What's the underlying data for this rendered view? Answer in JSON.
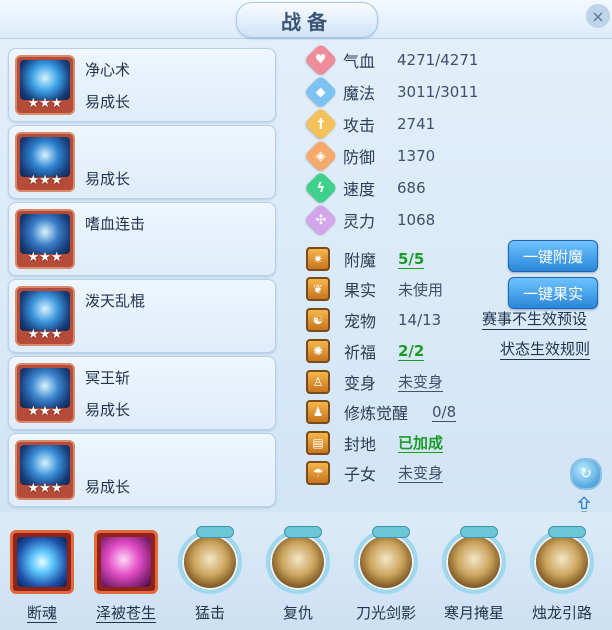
{
  "header": {
    "title": "战备",
    "close": "×"
  },
  "skills": [
    {
      "name": "净心术",
      "sub": "易成长",
      "stars": "★★★",
      "art": "#3aa0e6"
    },
    {
      "name": "",
      "sub": "易成长",
      "stars": "★★★",
      "art": "#2f84d1"
    },
    {
      "name": "嗜血连击",
      "sub": "",
      "stars": "★★★",
      "art": "#3c7ec9"
    },
    {
      "name": "泼天乱棍",
      "sub": "",
      "stars": "★★★",
      "art": "#3b95dc"
    },
    {
      "name": "冥王斩",
      "sub": "易成长",
      "stars": "★★★",
      "art": "#3c86cf"
    },
    {
      "name": "",
      "sub": "易成长",
      "stars": "★★★",
      "art": "#3a8fd7"
    }
  ],
  "stats": [
    {
      "label": "气血",
      "value": "4271/4271",
      "icon": "heart-icon",
      "color": "#f08c9a",
      "glyph": "♥"
    },
    {
      "label": "魔法",
      "value": "3011/3011",
      "icon": "mana-icon",
      "color": "#7cc2f2",
      "glyph": "◆"
    },
    {
      "label": "攻击",
      "value": "2741",
      "icon": "sword-icon",
      "color": "#f5c15a",
      "glyph": "†"
    },
    {
      "label": "防御",
      "value": "1370",
      "icon": "shield-icon",
      "color": "#f5aa6c",
      "glyph": "◈"
    },
    {
      "label": "速度",
      "value": "686",
      "icon": "speed-icon",
      "color": "#3fd08c",
      "glyph": "ϟ"
    },
    {
      "label": "灵力",
      "value": "1068",
      "icon": "spirit-icon",
      "color": "#d3a6ec",
      "glyph": "✣"
    }
  ],
  "equip": [
    {
      "label": "附魔",
      "value": "5/5",
      "green": true,
      "icon": "enchant-icon",
      "glyph": "✷"
    },
    {
      "label": "果实",
      "value": "未使用",
      "green": false,
      "plain": true,
      "icon": "fruit-icon",
      "glyph": "❦"
    },
    {
      "label": "宠物",
      "value": "14/13",
      "green": false,
      "plain": true,
      "icon": "pet-icon",
      "glyph": "☯"
    },
    {
      "label": "祈福",
      "value": "2/2",
      "green": true,
      "icon": "pray-icon",
      "glyph": "✺"
    },
    {
      "label": "变身",
      "value": "未变身",
      "green": false,
      "icon": "transform-icon",
      "glyph": "♙"
    },
    {
      "label": "修炼觉醒",
      "value": "0/8",
      "green": false,
      "icon": "cultivation-icon",
      "glyph": "♟"
    },
    {
      "label": "封地",
      "value": "已加成",
      "green": true,
      "icon": "fief-icon",
      "glyph": "▤"
    },
    {
      "label": "子女",
      "value": "未变身",
      "green": false,
      "icon": "children-icon",
      "glyph": "☂"
    }
  ],
  "buttons": {
    "enchant": "一键附魔",
    "fruit": "一键果实"
  },
  "links": {
    "preset": "赛事不生效预设",
    "rules": "状态生效规则"
  },
  "bottom_skills": [
    {
      "label": "断魂",
      "style": "square",
      "inner": "radial-gradient(circle at 50% 50%,#e8fbff 0%,#5fc9ff 30%,#1d4fa8 70%,#0b1f4a 100%)"
    },
    {
      "label": "泽被苍生",
      "style": "square",
      "inner": "radial-gradient(circle at 45% 45%,#ffd6f7 0%,#e24fc6 40%,#7a1c6e 80%,#3a0c33 100%)"
    },
    {
      "label": "猛击",
      "style": "ring"
    },
    {
      "label": "复仇",
      "style": "ring"
    },
    {
      "label": "刀光剑影",
      "style": "ring"
    },
    {
      "label": "寒月掩星",
      "style": "ring"
    },
    {
      "label": "烛龙引路",
      "style": "ring"
    }
  ]
}
